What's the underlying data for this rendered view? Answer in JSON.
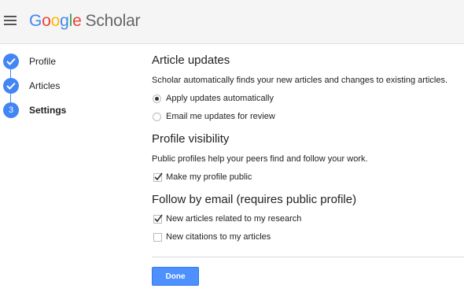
{
  "header": {
    "logo_letters": [
      "G",
      "o",
      "o",
      "g",
      "l",
      "e"
    ],
    "logo_suffix": "Scholar",
    "menu_icon": "hamburger-menu-icon"
  },
  "steps": [
    {
      "label": "Profile",
      "state": "completed",
      "icon": "checkmark-icon"
    },
    {
      "label": "Articles",
      "state": "completed",
      "icon": "checkmark-icon"
    },
    {
      "label": "Settings",
      "state": "current",
      "number": "3"
    }
  ],
  "article_updates": {
    "title": "Article updates",
    "description": "Scholar automatically finds your new articles and changes to existing articles.",
    "options": [
      {
        "label": "Apply updates automatically",
        "selected": true
      },
      {
        "label": "Email me updates for review",
        "selected": false
      }
    ]
  },
  "profile_visibility": {
    "title": "Profile visibility",
    "description": "Public profiles help your peers find and follow your work.",
    "checkbox_label": "Make my profile public",
    "checked": true
  },
  "follow_email": {
    "title": "Follow by email (requires public profile)",
    "options": [
      {
        "label": "New articles related to my research",
        "checked": true
      },
      {
        "label": "New citations to my articles",
        "checked": false
      }
    ]
  },
  "done_label": "Done",
  "colors": {
    "accent": "#4285f4",
    "button": "#4d90fe",
    "header_bg": "#f5f5f5"
  }
}
